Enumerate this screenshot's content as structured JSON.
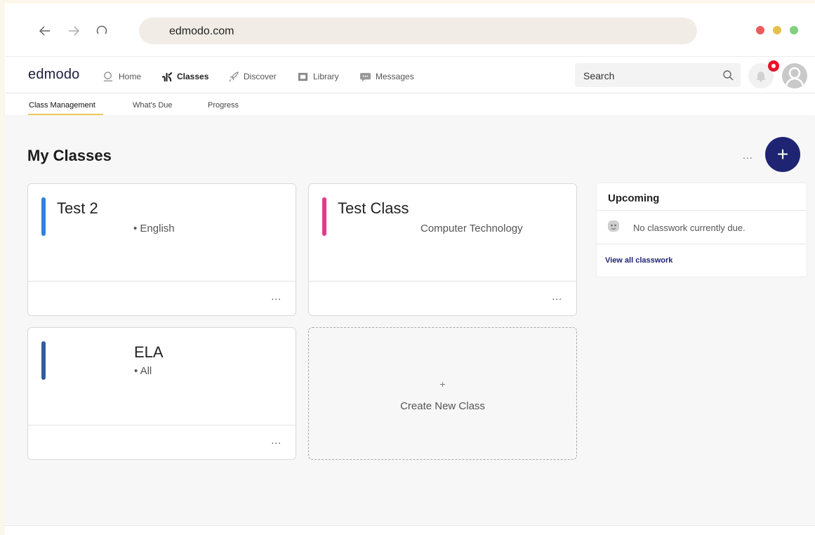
{
  "browser": {
    "url": "edmodo.com",
    "traffic_colors": [
      "#ee5a5a",
      "#e5c04d",
      "#7fd17d"
    ]
  },
  "app": {
    "logo": "edmodo",
    "nav": [
      {
        "label": "Home",
        "icon": "home-icon"
      },
      {
        "label": "Classes",
        "icon": "classes-icon"
      },
      {
        "label": "Discover",
        "icon": "rocket-icon"
      },
      {
        "label": "Library",
        "icon": "library-icon"
      },
      {
        "label": "Messages",
        "icon": "messages-icon"
      }
    ],
    "search_placeholder": "Search"
  },
  "subtabs": [
    "Class Management",
    "What's Due",
    "Progress"
  ],
  "main": {
    "title": "My Classes",
    "more": "...",
    "add": "+",
    "classes": [
      {
        "name": "Test 2",
        "subject": "• English",
        "color": "#2f82e0",
        "more": "..."
      },
      {
        "name": "Test Class",
        "subject": "Computer Technology",
        "color": "#e3398d",
        "more": "..."
      },
      {
        "name": "ELA",
        "subject": "• All",
        "color": "#2e5f9b",
        "more": "..."
      }
    ],
    "create": {
      "plus": "+",
      "label": "Create New Class"
    }
  },
  "upcoming": {
    "title": "Upcoming",
    "empty": "No classwork currently due.",
    "link": "View all classwork"
  },
  "colors": {
    "accent": "#1f2472",
    "tab_underline": "#f0c75e",
    "notification": "#e5162b"
  }
}
